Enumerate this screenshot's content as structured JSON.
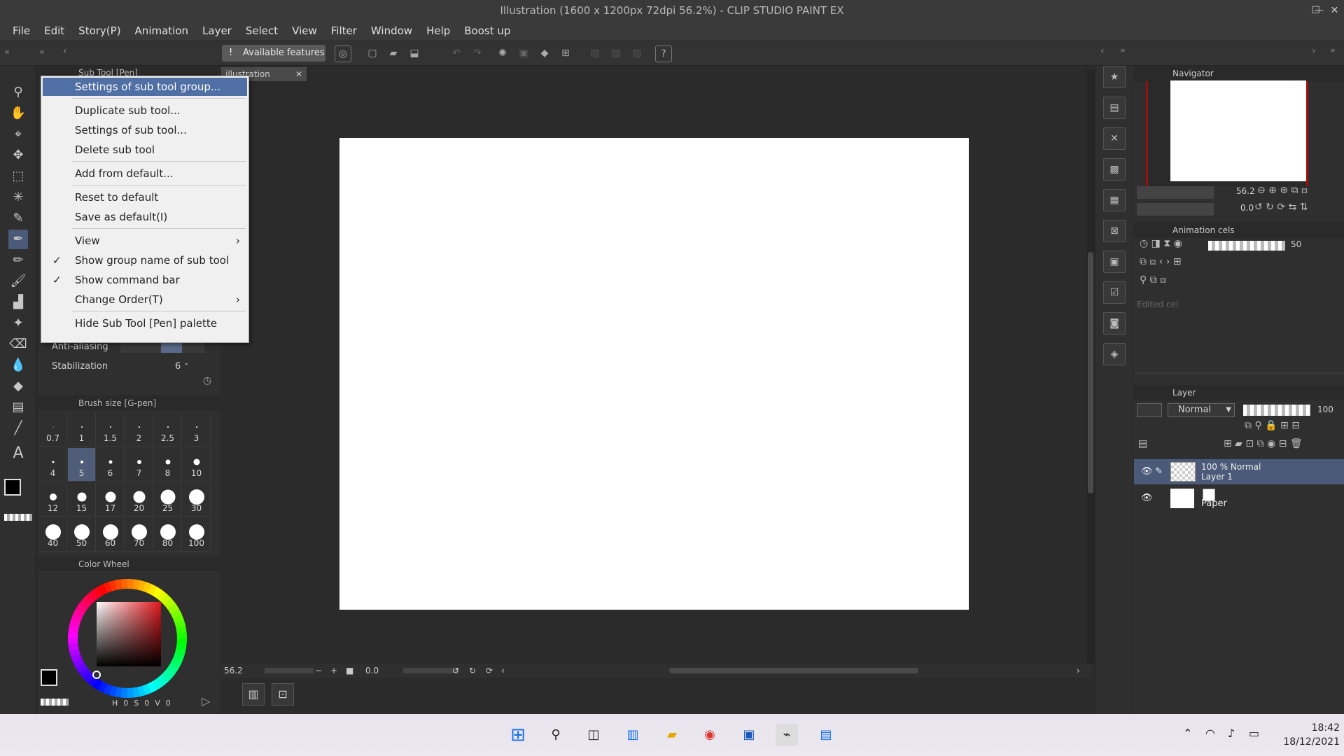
{
  "window": {
    "title": "Illustration (1600 x 1200px 72dpi 56.2%) - CLIP STUDIO PAINT EX"
  },
  "menubar": [
    "File",
    "Edit",
    "Story(P)",
    "Animation",
    "Layer",
    "Select",
    "View",
    "Filter",
    "Window",
    "Help",
    "Boost up"
  ],
  "command_bar": {
    "available_features": "Available features"
  },
  "subtool": {
    "header": "Sub Tool [Pen]",
    "antialiasing_label": "Anti-aliasing",
    "stabilization_label": "Stabilization",
    "stabilization_value": "6"
  },
  "context_menu": {
    "items": [
      {
        "label": "Settings of sub tool group...",
        "highlighted": true
      },
      {
        "label": "Duplicate sub tool..."
      },
      {
        "label": "Settings of sub tool..."
      },
      {
        "label": "Delete sub tool"
      },
      {
        "label": "Add from default..."
      },
      {
        "label": "Reset to default"
      },
      {
        "label": "Save as default(I)"
      },
      {
        "label": "View",
        "submenu": true
      },
      {
        "label": "Show group name of sub tool",
        "checked": true
      },
      {
        "label": "Show command bar",
        "checked": true
      },
      {
        "label": "Change Order(T)",
        "submenu": true
      },
      {
        "label": "Hide Sub Tool [Pen] palette"
      }
    ]
  },
  "brush_size": {
    "header": "Brush size [G-pen]",
    "sizes": [
      "0.7",
      "1",
      "1.5",
      "2",
      "2.5",
      "3",
      "4",
      "5",
      "6",
      "7",
      "8",
      "10",
      "12",
      "15",
      "17",
      "20",
      "25",
      "30",
      "40",
      "50",
      "60",
      "70",
      "80",
      "100"
    ],
    "selected": "5"
  },
  "color_wheel": {
    "header": "Color Wheel",
    "hsv": {
      "h_label": "H",
      "h": "0",
      "s_label": "S",
      "s": "0",
      "v_label": "V",
      "v": "0"
    }
  },
  "document_tab": {
    "label": "illustration"
  },
  "statusbar": {
    "zoom": "56.2",
    "rotation": "0.0"
  },
  "navigator": {
    "header": "Navigator",
    "zoom": "56.2",
    "rotation": "0.0"
  },
  "animation_cels": {
    "header": "Animation cels",
    "opacity": "50",
    "edited_cel": "Edited cel"
  },
  "layer_panel": {
    "header": "Layer",
    "blend_mode": "Normal",
    "opacity": "100",
    "layers": [
      {
        "line1": "100 % Normal",
        "line2": "Layer 1",
        "selected": true
      },
      {
        "line1": "",
        "line2": "Paper",
        "selected": false
      }
    ]
  },
  "taskbar": {
    "time": "18:42",
    "date": "18/12/2021"
  },
  "colors": {
    "accent": "#4f6fa5",
    "bg": "#2b2b2b",
    "panel": "#2f2f2f"
  }
}
